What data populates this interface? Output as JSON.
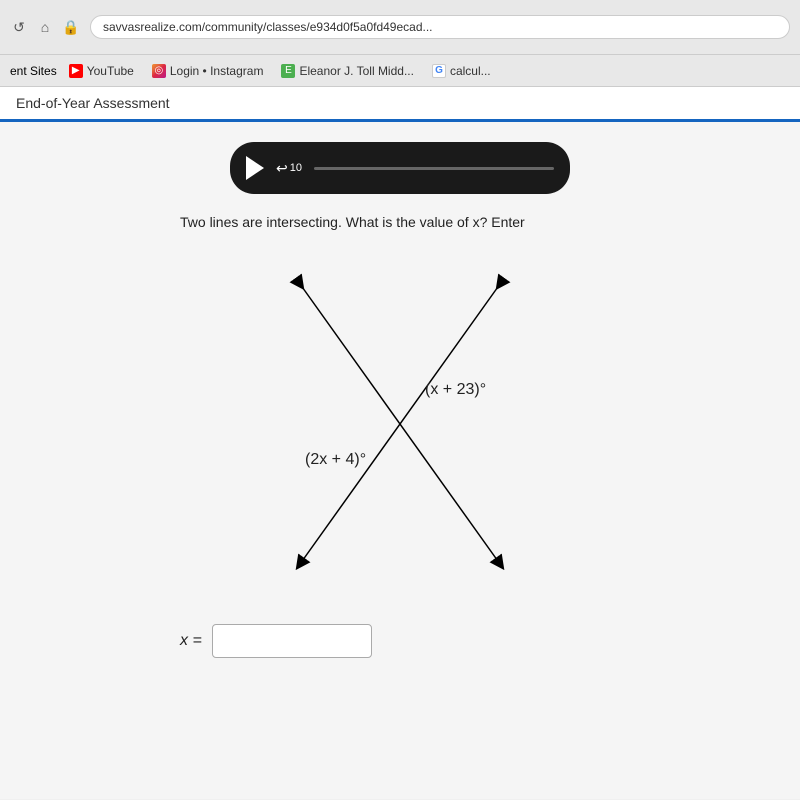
{
  "browser": {
    "address": "savvasrealize.com/community/classes/e934d0f5a0fd49ecad...",
    "nav": {
      "back": "←",
      "reload": "↺",
      "lock": "🔒"
    }
  },
  "bookmarks": {
    "label": "ent Sites",
    "items": [
      {
        "id": "youtube",
        "label": "YouTube",
        "icon": "▶",
        "iconClass": "yt-icon"
      },
      {
        "id": "instagram",
        "label": "Login • Instagram",
        "icon": "◎",
        "iconClass": "ig-icon"
      },
      {
        "id": "eleanor",
        "label": "Eleanor J. Toll Midd...",
        "icon": "E",
        "iconClass": "savvas-icon"
      },
      {
        "id": "calcul",
        "label": "calcul...",
        "icon": "G",
        "iconClass": "google-icon"
      }
    ]
  },
  "page": {
    "title": "End-of-Year Assessment"
  },
  "question": {
    "text": "Two lines are intersecting. What is the value of x? Enter",
    "angle1": "(x + 23)°",
    "angle2": "(2x + 4)°",
    "x_label": "x =",
    "input_placeholder": ""
  },
  "video": {
    "replay_label": "10"
  }
}
